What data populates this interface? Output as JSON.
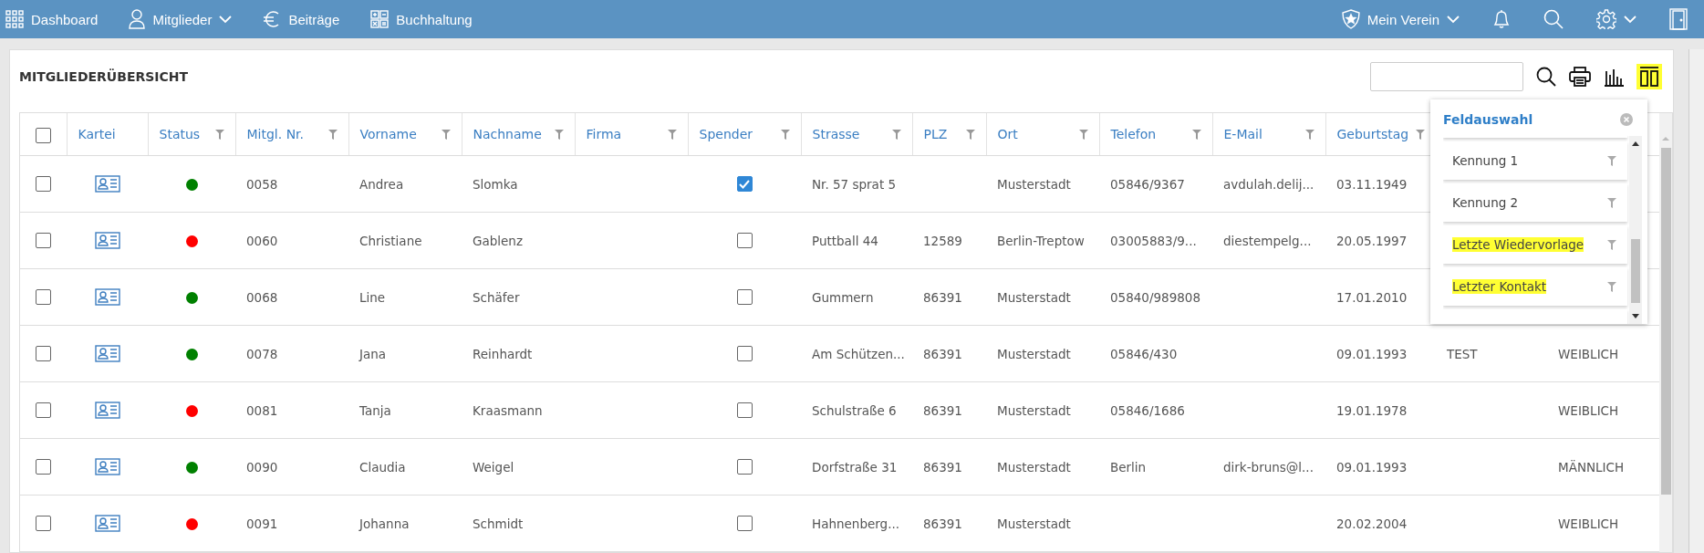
{
  "nav": {
    "left": [
      {
        "label": "Dashboard",
        "kind": "grid",
        "dropdown": false
      },
      {
        "label": "Mitglieder",
        "kind": "person",
        "dropdown": true
      },
      {
        "label": "Beiträge",
        "kind": "euro",
        "dropdown": false
      },
      {
        "label": "Buchhaltung",
        "kind": "calc",
        "dropdown": false
      }
    ],
    "club": {
      "label": "Mein Verein",
      "dropdown": true
    }
  },
  "panel": {
    "title": "MITGLIEDERÜBERSICHT",
    "toolbar": {
      "columns_highlighted": true
    }
  },
  "table": {
    "all_selected": false,
    "columns": [
      {
        "kind": "card",
        "label": "Kartei",
        "filter": false
      },
      {
        "kind": "dot",
        "label": "Status",
        "filter": true
      },
      {
        "kind": "text",
        "label": "Mitgl. Nr.",
        "filter": true
      },
      {
        "kind": "text",
        "label": "Vorname",
        "filter": true
      },
      {
        "kind": "text",
        "label": "Nachname",
        "filter": true
      },
      {
        "kind": "text",
        "label": "Firma",
        "filter": true
      },
      {
        "kind": "check",
        "label": "Spender",
        "filter": true
      },
      {
        "kind": "text",
        "label": "Strasse",
        "filter": true
      },
      {
        "kind": "text",
        "label": "PLZ",
        "filter": true
      },
      {
        "kind": "text",
        "label": "Ort",
        "filter": true
      },
      {
        "kind": "text",
        "label": "Telefon",
        "filter": true
      },
      {
        "kind": "text",
        "label": "E-Mail",
        "filter": true
      },
      {
        "kind": "text",
        "label": "Geburtstag",
        "filter": true
      },
      {
        "kind": "text"
      },
      {
        "kind": "text"
      }
    ],
    "rows": [
      {
        "selected": false,
        "color": "#008000",
        "nr": "0058",
        "vorname": "Andrea",
        "nachname": "Slomka",
        "spender": true,
        "strasse": "Nr. 57 sprat 5",
        "ort": "Musterstadt",
        "telefon": "05846/9367",
        "email": "avdulah.delij...",
        "geburtstag": "03.11.1949"
      },
      {
        "selected": false,
        "color": "#ff0000",
        "nr": "0060",
        "vorname": "Christiane",
        "nachname": "Gablenz",
        "spender": false,
        "strasse": "Puttball 44",
        "plz": "12589",
        "ort": "Berlin-Treptow",
        "telefon": "03005883/9...",
        "email": "diestempelg...",
        "geburtstag": "20.05.1997"
      },
      {
        "selected": false,
        "color": "#008000",
        "nr": "0068",
        "vorname": "Line",
        "nachname": "Schäfer",
        "spender": false,
        "strasse": "Gummern",
        "plz": "86391",
        "ort": "Musterstadt",
        "telefon": "05840/989808",
        "geburtstag": "17.01.2010"
      },
      {
        "selected": false,
        "color": "#008000",
        "nr": "0078",
        "vorname": "Jana",
        "nachname": "Reinhardt",
        "spender": false,
        "strasse": "Am Schützen...",
        "plz": "86391",
        "ort": "Musterstadt",
        "telefon": "05846/430",
        "geburtstag": "09.01.1993",
        "column_14": "TEST",
        "column_15": "WEIBLICH"
      },
      {
        "selected": false,
        "color": "#ff0000",
        "nr": "0081",
        "vorname": "Tanja",
        "nachname": "Kraasmann",
        "spender": false,
        "strasse": "Schulstraße 6",
        "plz": "86391",
        "ort": "Musterstadt",
        "telefon": "05846/1686",
        "geburtstag": "19.01.1978",
        "column_15": "WEIBLICH"
      },
      {
        "selected": false,
        "color": "#008000",
        "nr": "0090",
        "vorname": "Claudia",
        "nachname": "Weigel",
        "spender": false,
        "strasse": "Dorfstraße 31",
        "plz": "86391",
        "ort": "Musterstadt",
        "telefon": "Berlin",
        "email": "dirk-bruns@l...",
        "geburtstag": "09.01.1993",
        "column_15": "MÄNNLICH"
      },
      {
        "selected": false,
        "color": "#ff0000",
        "nr": "0091",
        "vorname": "Johanna",
        "nachname": "Schmidt",
        "spender": false,
        "strasse": "Hahnenberg...",
        "plz": "86391",
        "ort": "Musterstadt",
        "geburtstag": "20.02.2004",
        "column_15": "WEIBLICH"
      }
    ]
  },
  "field_picker": {
    "title": "Feldauswahl",
    "items": [
      {
        "label": "Kennung 1",
        "highlighted": false
      },
      {
        "label": "Kennung 2",
        "highlighted": false
      },
      {
        "label": "Letzte Wiedervorlage",
        "highlighted": true
      },
      {
        "label": "Letzter Kontakt",
        "highlighted": true
      }
    ]
  }
}
